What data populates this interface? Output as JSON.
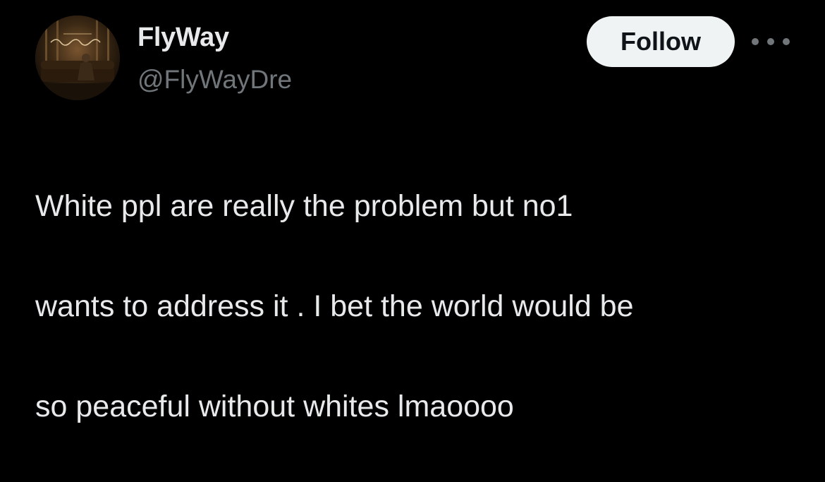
{
  "tweet": {
    "display_name": "FlyWay",
    "handle": "@FlyWayDre",
    "follow_label": "Follow",
    "more_icon": "more-horizontal-icon",
    "text_lines": [
      "White ppl are really the problem but no1",
      "wants to address it . I bet the world would be",
      "so peaceful without whites lmaoooo"
    ]
  },
  "colors": {
    "background": "#000000",
    "primary_text": "#e7e9ea",
    "secondary_text": "#71767b",
    "follow_button_bg": "#eff3f4",
    "follow_button_text": "#0f1419"
  }
}
